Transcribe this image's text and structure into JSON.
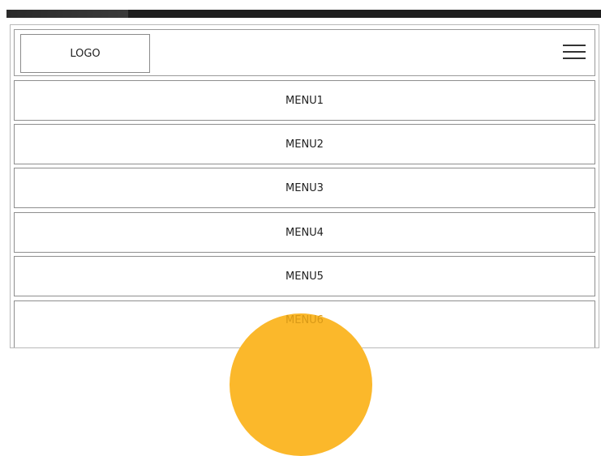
{
  "header": {
    "logo_text": "LOGO",
    "menu_icon": "hamburger-menu-icon"
  },
  "menu": {
    "items": [
      {
        "label": "MENU1"
      },
      {
        "label": "MENU2"
      },
      {
        "label": "MENU3"
      },
      {
        "label": "MENU4"
      },
      {
        "label": "MENU5"
      },
      {
        "label": "MENU6"
      }
    ]
  },
  "colors": {
    "accent": "#fbb82b",
    "border": "#8e8e8e"
  }
}
